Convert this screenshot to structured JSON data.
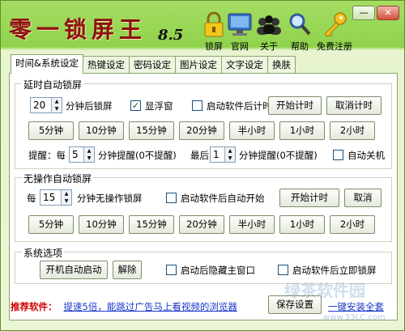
{
  "app": {
    "title": "零一锁屏王",
    "version": "8.5"
  },
  "toolbar": [
    {
      "label": "锁屏",
      "icon": "lock-icon"
    },
    {
      "label": "官网",
      "icon": "monitor-icon"
    },
    {
      "label": "关于",
      "icon": "users-icon"
    },
    {
      "label": "帮助",
      "icon": "magnifier-icon"
    },
    {
      "label": "免费注册",
      "icon": "key-icon"
    }
  ],
  "window_buttons": {
    "minimize": "—",
    "close": "✕"
  },
  "tabs": [
    "时间&系统设定",
    "热键设定",
    "密码设定",
    "图片设定",
    "文字设定",
    "换肤"
  ],
  "delay": {
    "legend": "延时自动锁屏",
    "minutes": "20",
    "minutes_unit": "分钟后锁屏",
    "show_float": "显浮窗",
    "show_float_checked": true,
    "start_on_launch": "启动软件后计时",
    "start_on_launch_checked": false,
    "start_btn": "开始计时",
    "cancel_btn": "取消计时",
    "presets": [
      "5分钟",
      "10分钟",
      "15分钟",
      "20分钟",
      "半小时",
      "1小时",
      "2小时"
    ],
    "remind_prefix": "提醒：每",
    "remind_every": "5",
    "remind_every_unit": "分钟提醒(0不提醒)",
    "remind_last_prefix": "最后",
    "remind_last": "1",
    "remind_last_unit": "分钟提醒(0不提醒)",
    "auto_shutdown": "自动关机",
    "auto_shutdown_checked": false
  },
  "idle": {
    "legend": "无操作自动锁屏",
    "prefix": "每",
    "minutes": "15",
    "unit": "分钟无操作锁屏",
    "start_on_launch": "启动软件后自动开始",
    "start_on_launch_checked": false,
    "start_btn": "开始计时",
    "cancel_btn": "取消",
    "presets": [
      "5分钟",
      "10分钟",
      "15分钟",
      "20分钟",
      "半小时",
      "1小时",
      "2小时"
    ]
  },
  "system": {
    "legend": "系统选项",
    "autostart_btn": "开机自动启动",
    "remove_btn": "解除",
    "hide_main": "启动后隐藏主窗口",
    "hide_main_checked": false,
    "lock_on_start": "启动软件后立即锁屏",
    "lock_on_start_checked": false
  },
  "footer": {
    "recommend_label": "推荐软件：",
    "recommend_link": "提速5倍，能跳过广告马上看视频的浏览器",
    "save_btn": "保存设置",
    "link2": "一键安装全套"
  },
  "watermark": {
    "text": "绿茶软件园",
    "url": "www.33LC.com"
  }
}
